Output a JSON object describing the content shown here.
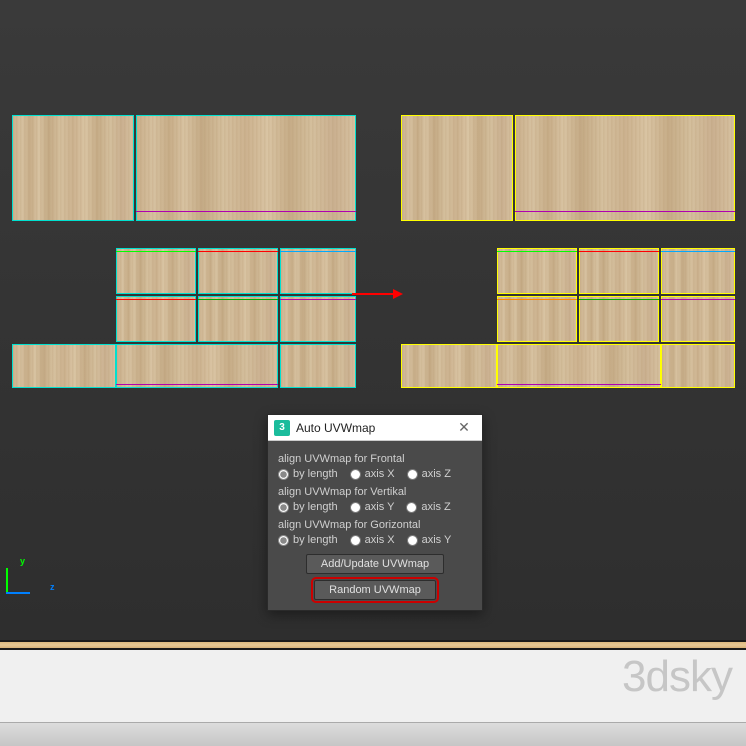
{
  "dialog": {
    "title": "Auto UVWmap",
    "app_icon_label": "3",
    "groups": [
      {
        "label": "align UVWmap for Frontal",
        "options": [
          {
            "label": "by length",
            "checked": true
          },
          {
            "label": "axis X",
            "checked": false
          },
          {
            "label": "axis Z",
            "checked": false
          }
        ]
      },
      {
        "label": "align UVWmap for Vertikal",
        "options": [
          {
            "label": "by length",
            "checked": true
          },
          {
            "label": "axis Y",
            "checked": false
          },
          {
            "label": "axis Z",
            "checked": false
          }
        ]
      },
      {
        "label": "align UVWmap for Gorizontal",
        "options": [
          {
            "label": "by length",
            "checked": true
          },
          {
            "label": "axis X",
            "checked": false
          },
          {
            "label": "axis Y",
            "checked": false
          }
        ]
      }
    ],
    "buttons": {
      "add_update": "Add/Update UVWmap",
      "random": "Random UVWmap"
    }
  },
  "axis": {
    "y_label": "y",
    "z_label": "z"
  },
  "watermark": "3dsky",
  "colors": {
    "selection_before": "#00e0d0",
    "selection_after": "#ffff00",
    "arrow": "#ff0000",
    "highlight_box": "#c00"
  }
}
